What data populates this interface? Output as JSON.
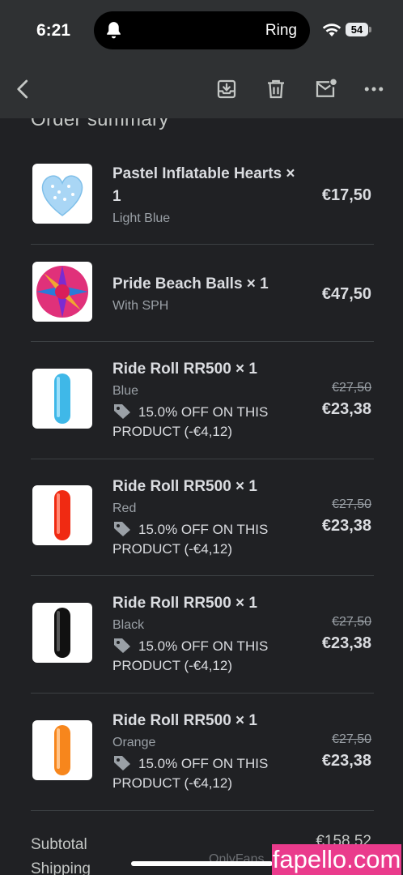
{
  "status_bar": {
    "time": "6:21",
    "island_text": "Ring",
    "battery": "54"
  },
  "toolbar": {
    "back_icon": "chevron-left-icon",
    "archive_icon": "archive-icon",
    "delete_icon": "trash-icon",
    "mark_unread_icon": "mail-unread-icon",
    "more_icon": "more-horizontal-icon"
  },
  "order": {
    "title": "Order summary",
    "items": [
      {
        "name": "Pastel Inflatable Hearts × 1",
        "variant": "Light Blue",
        "price": "€17,50",
        "image": "heart-balloon"
      },
      {
        "name": "Pride Beach Balls × 1",
        "variant": "With SPH",
        "price": "€47,50",
        "image": "beach-ball"
      },
      {
        "name": "Ride Roll RR500 × 1",
        "variant": "Blue",
        "discount": "15.0% OFF ON THIS PRODUCT (-€4,12)",
        "old_price": "€27,50",
        "price": "€23,38",
        "image": "roll-blue"
      },
      {
        "name": "Ride Roll RR500 × 1",
        "variant": "Red",
        "discount": "15.0% OFF ON THIS PRODUCT (-€4,12)",
        "old_price": "€27,50",
        "price": "€23,38",
        "image": "roll-red"
      },
      {
        "name": "Ride Roll RR500 × 1",
        "variant": "Black",
        "discount": "15.0% OFF ON THIS PRODUCT (-€4,12)",
        "old_price": "€27,50",
        "price": "€23,38",
        "image": "roll-black"
      },
      {
        "name": "Ride Roll RR500 × 1",
        "variant": "Orange",
        "discount": "15.0% OFF ON THIS PRODUCT (-€4,12)",
        "old_price": "€27,50",
        "price": "€23,38",
        "image": "roll-orange"
      }
    ],
    "subtotal_label": "Subtotal",
    "subtotal_value": "€158,52",
    "shipping_label": "Shipping"
  },
  "colors": {
    "background": "#202124",
    "toolbar": "#2f3133",
    "roll_blue": "#3fb8e8",
    "roll_red": "#f02a12",
    "roll_black": "#111111",
    "roll_orange": "#f7861c"
  },
  "watermarks": {
    "onlyfans": "OnlyFans.",
    "site": "fapello.com"
  }
}
